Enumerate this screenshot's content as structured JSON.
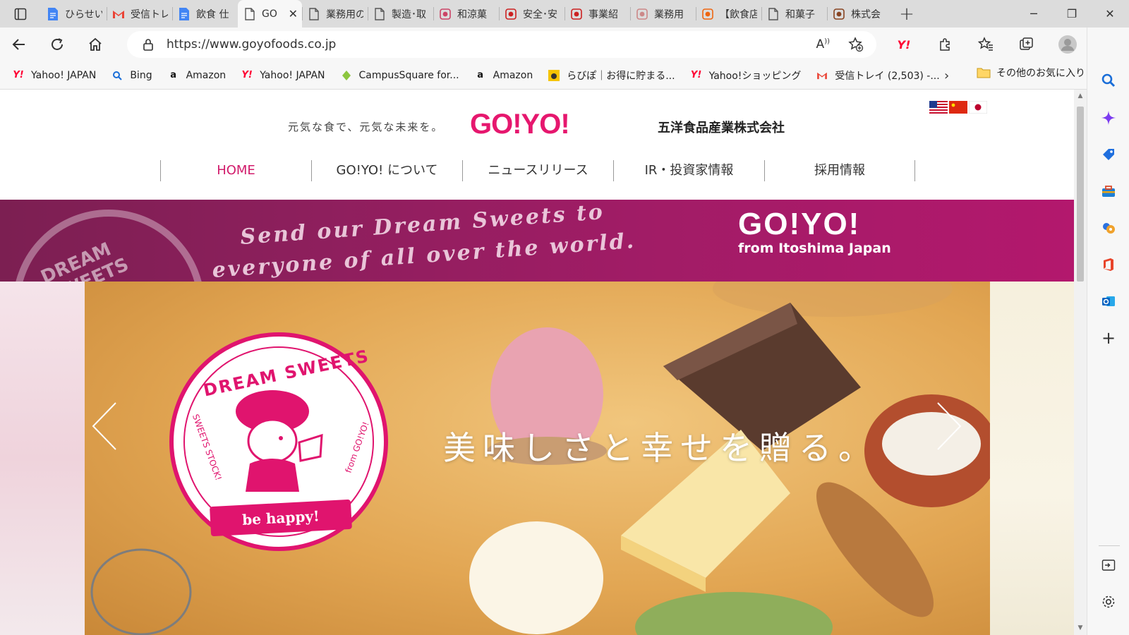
{
  "browser": {
    "tabs": [
      {
        "title": "ひらせい",
        "icon": "google-docs-icon",
        "color": "#4285f4"
      },
      {
        "title": "受信トレ",
        "icon": "gmail-icon",
        "color": "#ea4335"
      },
      {
        "title": "飲食 仕",
        "icon": "google-docs-icon",
        "color": "#4285f4"
      },
      {
        "title": "GO",
        "icon": "page-icon",
        "color": "#555555",
        "active": true
      },
      {
        "title": "業務用の",
        "icon": "page-icon",
        "color": "#555555"
      },
      {
        "title": "製造･取",
        "icon": "page-icon",
        "color": "#555555"
      },
      {
        "title": "和涼菓",
        "icon": "site-icon",
        "color": "#cc4466"
      },
      {
        "title": "安全･安",
        "icon": "site-icon",
        "color": "#cc2222"
      },
      {
        "title": "事業紹",
        "icon": "site-icon",
        "color": "#cc2222"
      },
      {
        "title": "業務用",
        "icon": "site-icon",
        "color": "#cc8888"
      },
      {
        "title": "【飲食店",
        "icon": "site-icon",
        "color": "#ee6611"
      },
      {
        "title": "和菓子",
        "icon": "page-icon",
        "color": "#555555"
      },
      {
        "title": "株式会",
        "icon": "site-icon",
        "color": "#884422"
      }
    ],
    "url": "https://www.goyofoods.co.jp",
    "bookmarks": [
      {
        "label": "Yahoo! JAPAN",
        "icon": "yahoo-icon"
      },
      {
        "label": "Bing",
        "icon": "search-icon"
      },
      {
        "label": "Amazon",
        "icon": "amazon-icon"
      },
      {
        "label": "Yahoo! JAPAN",
        "icon": "yahoo-icon"
      },
      {
        "label": "CampusSquare for...",
        "icon": "campussquare-icon"
      },
      {
        "label": "Amazon",
        "icon": "amazon-icon"
      },
      {
        "label": "らびぽ｜お得に貯まる...",
        "icon": "rabipo-icon"
      },
      {
        "label": "Yahoo!ショッピング",
        "icon": "yahoo-icon"
      },
      {
        "label": "受信トレイ (2,503) -...",
        "icon": "gmail-icon"
      }
    ],
    "other_bookmarks": "その他のお気に入り"
  },
  "site": {
    "tagline": "元気な食で、元気な未来を。",
    "logo": "GO!YO!",
    "company": "五洋食品産業株式会社",
    "flags": [
      "us-flag",
      "cn-flag",
      "jp-flag"
    ],
    "nav": [
      {
        "label": "HOME",
        "current": true
      },
      {
        "label": "GO!YO! について"
      },
      {
        "label": "ニュースリリース"
      },
      {
        "label": "IR・投資家情報"
      },
      {
        "label": "採用情報"
      }
    ],
    "banner": {
      "script_line1": "Send our Dream Sweets to",
      "script_line2": "everyone  of all over the world.",
      "stamp_text": "DREAM SWEETS",
      "brand": "GO!YO!",
      "brand_sub": "from Itoshima Japan"
    },
    "hero": {
      "catch": "美味しさと幸せを贈る。",
      "logo_arc": "DREAM SWEETS",
      "logo_left": "SWEETS STOCK!",
      "logo_right": "from GO!YO!",
      "logo_ribbon": "be happy!",
      "accent": "#e0146e"
    }
  }
}
